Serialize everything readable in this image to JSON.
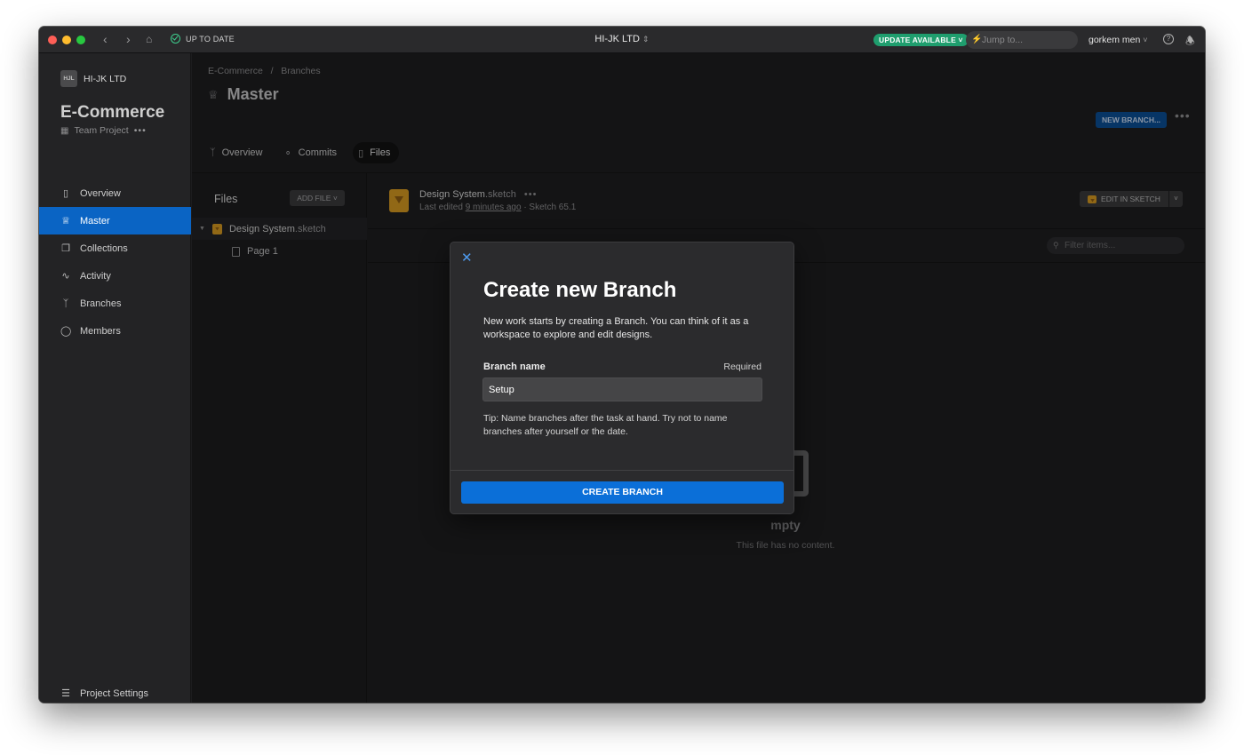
{
  "titlebar": {
    "status": "UP TO DATE",
    "workspace": "HI-JK LTD",
    "update_badge": "UPDATE AVAILABLE",
    "jump_placeholder": "Jump to...",
    "user": "gorkem men"
  },
  "sidebar": {
    "org_initials": "HJL",
    "org_name": "HI-JK LTD",
    "project_title": "E-Commerce",
    "project_type": "Team Project",
    "items": [
      {
        "label": "Overview",
        "icon": "document-icon"
      },
      {
        "label": "Master",
        "icon": "crown-icon",
        "active": true
      },
      {
        "label": "Collections",
        "icon": "collections-icon"
      },
      {
        "label": "Activity",
        "icon": "activity-icon"
      },
      {
        "label": "Branches",
        "icon": "branch-icon"
      },
      {
        "label": "Members",
        "icon": "person-icon"
      }
    ],
    "settings_label": "Project Settings"
  },
  "header": {
    "breadcrumb": [
      "E-Commerce",
      "Branches"
    ],
    "title": "Master",
    "new_branch_label": "NEW BRANCH...",
    "tabs": [
      {
        "label": "Overview"
      },
      {
        "label": "Commits"
      },
      {
        "label": "Files",
        "active": true
      }
    ]
  },
  "files": {
    "heading": "Files",
    "add_file_label": "ADD FILE",
    "tree": {
      "file_name": "Design System",
      "file_ext": ".sketch",
      "pages": [
        "Page 1"
      ]
    }
  },
  "document": {
    "name": "Design System",
    "ext": ".sketch",
    "meta_prefix": "Last edited",
    "meta_time": "9 minutes ago",
    "meta_suffix": "· Sketch 65.1",
    "edit_label": "EDIT IN SKETCH",
    "filter_placeholder": "Filter items...",
    "empty_title": "mpty",
    "empty_sub": "This file has no content."
  },
  "modal": {
    "title": "Create new Branch",
    "description": "New work starts by creating a Branch. You can think of it as a workspace to explore and edit designs.",
    "field_label": "Branch name",
    "field_required": "Required",
    "field_value": "Setup",
    "tip": "Tip: Name branches after the task at hand. Try not to name branches after yourself or the date.",
    "create_label": "CREATE BRANCH"
  },
  "colors": {
    "accent": "#0b6fd8",
    "active_nav": "#0a64c4",
    "update_badge": "#1f9e6e",
    "sketch": "#d69a21"
  }
}
